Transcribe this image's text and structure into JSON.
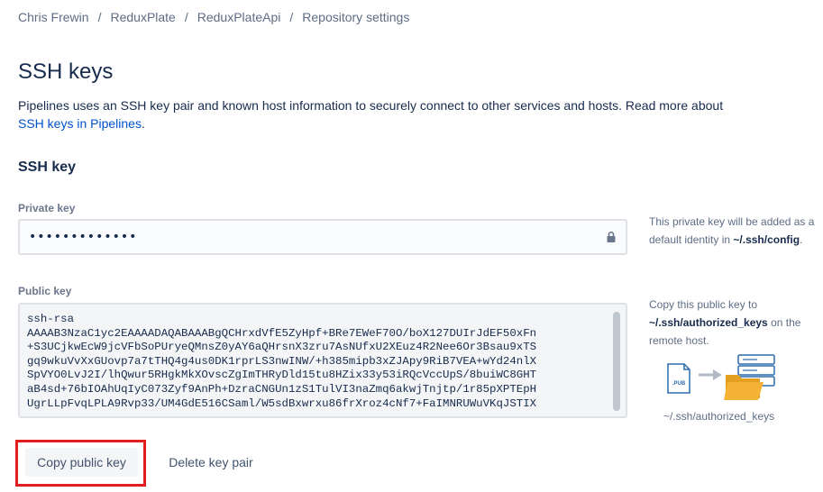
{
  "breadcrumb": {
    "items": [
      "Chris Frewin",
      "ReduxPlate",
      "ReduxPlateApi",
      "Repository settings"
    ],
    "separator": "/"
  },
  "page": {
    "title": "SSH keys",
    "intro_text": "Pipelines uses an SSH key pair and known host information to securely connect to other services and hosts. Read more about ",
    "intro_link": "SSH keys in Pipelines",
    "intro_end": "."
  },
  "ssh_key": {
    "section_title": "SSH key",
    "private_label": "Private key",
    "private_value": "•••••••••••••",
    "public_label": "Public key",
    "public_value": "ssh-rsa\nAAAAB3NzaC1yc2EAAAADAQABAAABgQCHrxdVfE5ZyHpf+BRe7EWeF70O/boX127DUIrJdEF50xFn\n+S3UCjkwEcW9jcVFbSoPUryeQMnsZ0yAY6aQHrsnX3zru7AsNUfxU2XEuz4R2Nee6Or3Bsau9xTS\ngq9wkuVvXxGUovp7a7tTHQ4g4us0DK1rprLS3nwINW/+h385mipb3xZJApy9RiB7VEA+wYd24nlX\nSpVYO0LvJ2I/lhQwur5RHgkMkXOvscZgImTHRyDld15tu8HZix33y53iRQcVccUpS/8buiWC8GHT\naB4sd+76bIOAhUqIyC073Zyf9AnPh+DzraCNGUn1zS1TulVI3naZmq6akwjTnjtp/1r85pXPTEpH\nUgrLLpFvqLPLA9Rvp33/UM4GdE516CSaml/W5sdBxwrxu86frXroz4cNf7+FaIMNRUWuVKqJSTIX",
    "private_help": "This private key will be added as a default identity in ",
    "private_help_path": "~/.ssh/config",
    "private_help_end": ".",
    "public_help_1": "Copy this public key to ",
    "public_help_path": "~/.ssh/authorized_keys",
    "public_help_2": " on the remote host.",
    "illustration_caption": "~/.ssh/authorized_keys",
    "illustration_file_tag": ".PUB"
  },
  "actions": {
    "copy_label": "Copy public key",
    "delete_label": "Delete key pair"
  },
  "colors": {
    "link": "#0052cc",
    "highlight_border": "#e11d1d",
    "folder": "#f5a623",
    "server": "#2b6cb0"
  }
}
